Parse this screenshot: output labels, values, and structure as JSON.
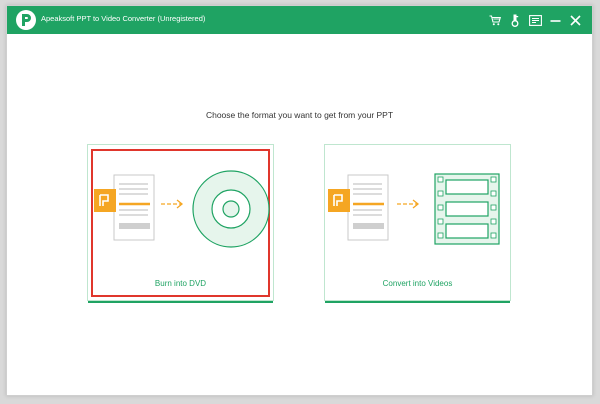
{
  "window": {
    "title": "Apeaksoft PPT to Video Converter (Unregistered)"
  },
  "toolbar": {
    "icons": [
      "cart-icon",
      "key-icon",
      "feedback-icon",
      "minimize-icon",
      "close-icon"
    ]
  },
  "main": {
    "prompt": "Choose the format you want to get from your PPT",
    "options": [
      {
        "label": "Burn into DVD",
        "selected": true
      },
      {
        "label": "Convert into Videos",
        "selected": false
      }
    ]
  },
  "colors": {
    "brand_green": "#1fa363",
    "accent_orange": "#f5a623",
    "selection_red": "#e0362c"
  }
}
